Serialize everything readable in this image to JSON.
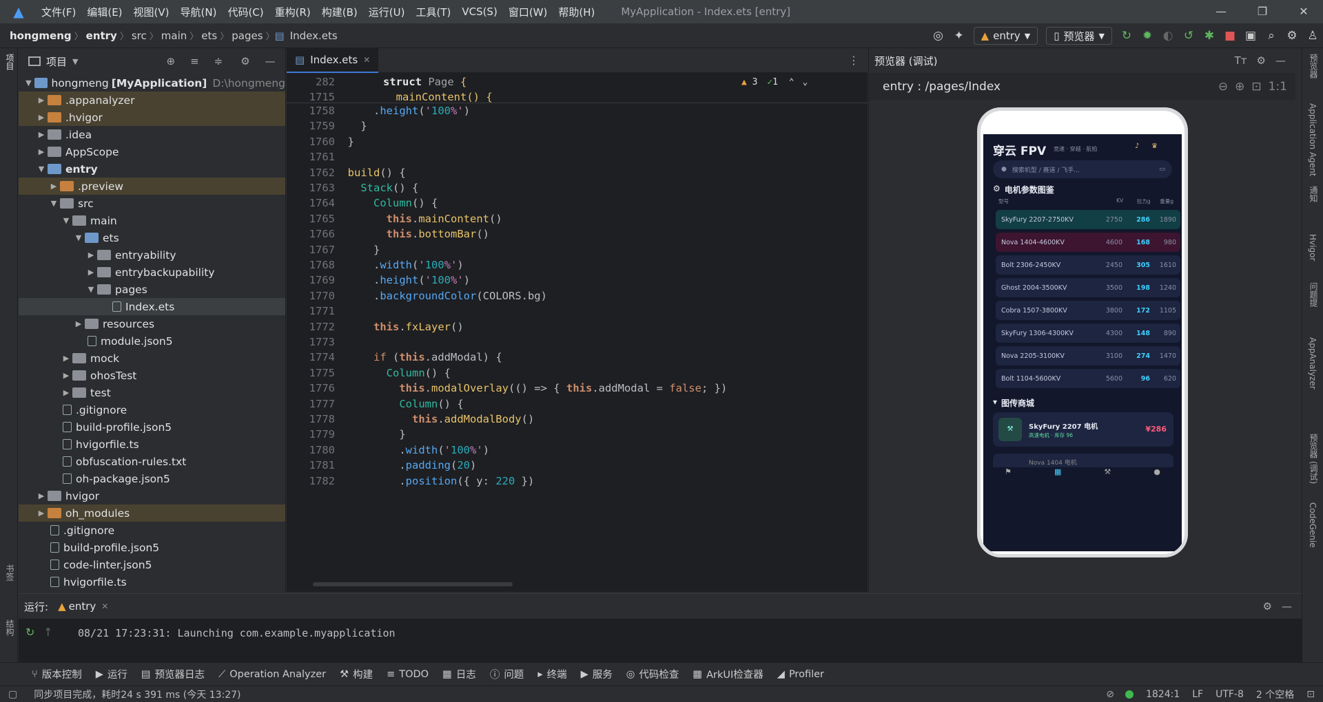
{
  "menubar": {
    "items": [
      "文件(F)",
      "编辑(E)",
      "视图(V)",
      "导航(N)",
      "代码(C)",
      "重构(R)",
      "构建(B)",
      "运行(U)",
      "工具(T)",
      "VCS(S)",
      "窗口(W)",
      "帮助(H)"
    ],
    "title": "MyApplication - Index.ets [entry]"
  },
  "breadcrumb": [
    "hongmeng",
    "entry",
    "src",
    "main",
    "ets",
    "pages",
    "Index.ets"
  ],
  "toolbar": {
    "run_config": "entry",
    "device": "预览器"
  },
  "project": {
    "title": "项目",
    "tree": [
      {
        "label": "hongmeng",
        "extra": "[MyApplication]",
        "path": "D:\\hongmeng",
        "depth": 0,
        "open": true,
        "kind": "b"
      },
      {
        "label": ".appanalyzer",
        "depth": 1,
        "open": false,
        "kind": "o",
        "hl": true
      },
      {
        "label": ".hvigor",
        "depth": 1,
        "open": false,
        "kind": "o",
        "hl": true
      },
      {
        "label": ".idea",
        "depth": 1,
        "open": false,
        "kind": "g"
      },
      {
        "label": "AppScope",
        "depth": 1,
        "open": false,
        "kind": "g"
      },
      {
        "label": "entry",
        "depth": 1,
        "open": true,
        "kind": "b",
        "bold": true
      },
      {
        "label": ".preview",
        "depth": 2,
        "open": false,
        "kind": "o",
        "hl": true
      },
      {
        "label": "src",
        "depth": 2,
        "open": true,
        "kind": "g"
      },
      {
        "label": "main",
        "depth": 3,
        "open": true,
        "kind": "g"
      },
      {
        "label": "ets",
        "depth": 4,
        "open": true,
        "kind": "b"
      },
      {
        "label": "entryability",
        "depth": 5,
        "open": false,
        "kind": "g"
      },
      {
        "label": "entrybackupability",
        "depth": 5,
        "open": false,
        "kind": "g"
      },
      {
        "label": "pages",
        "depth": 5,
        "open": true,
        "kind": "g"
      },
      {
        "label": "Index.ets",
        "depth": 6,
        "file": true
      },
      {
        "label": "resources",
        "depth": 4,
        "open": false,
        "kind": "g"
      },
      {
        "label": "module.json5",
        "depth": 4,
        "file": true
      },
      {
        "label": "mock",
        "depth": 3,
        "open": false,
        "kind": "g"
      },
      {
        "label": "ohosTest",
        "depth": 3,
        "open": false,
        "kind": "g"
      },
      {
        "label": "test",
        "depth": 3,
        "open": false,
        "kind": "g"
      },
      {
        "label": ".gitignore",
        "depth": 2,
        "file": true
      },
      {
        "label": "build-profile.json5",
        "depth": 2,
        "file": true
      },
      {
        "label": "hvigorfile.ts",
        "depth": 2,
        "file": true
      },
      {
        "label": "obfuscation-rules.txt",
        "depth": 2,
        "file": true
      },
      {
        "label": "oh-package.json5",
        "depth": 2,
        "file": true
      },
      {
        "label": "hvigor",
        "depth": 1,
        "open": false,
        "kind": "g"
      },
      {
        "label": "oh_modules",
        "depth": 1,
        "open": false,
        "kind": "o",
        "hl": true
      },
      {
        "label": ".gitignore",
        "depth": 1,
        "file": true
      },
      {
        "label": "build-profile.json5",
        "depth": 1,
        "file": true
      },
      {
        "label": "code-linter.json5",
        "depth": 1,
        "file": true
      },
      {
        "label": "hvigorfile.ts",
        "depth": 1,
        "file": true
      }
    ]
  },
  "editor": {
    "tab": "Index.ets",
    "sticky": [
      [
        "282",
        "struct Page {"
      ],
      [
        "1715",
        "  mainContent() {"
      ]
    ],
    "warnings": "3",
    "ok": "1",
    "lines": [
      [
        "1758",
        "      .height('100%')"
      ],
      [
        "1759",
        "    }"
      ],
      [
        "1760",
        "  }"
      ],
      [
        "1761",
        ""
      ],
      [
        "1762",
        "  build() {"
      ],
      [
        "1763",
        "    Stack() {"
      ],
      [
        "1764",
        "      Column() {"
      ],
      [
        "1765",
        "        this.mainContent()"
      ],
      [
        "1766",
        "        this.bottomBar()"
      ],
      [
        "1767",
        "      }"
      ],
      [
        "1768",
        "      .width('100%')"
      ],
      [
        "1769",
        "      .height('100%')"
      ],
      [
        "1770",
        "      .backgroundColor(COLORS.bg)"
      ],
      [
        "1771",
        ""
      ],
      [
        "1772",
        "      this.fxLayer()"
      ],
      [
        "1773",
        ""
      ],
      [
        "1774",
        "      if (this.addModal) {"
      ],
      [
        "1775",
        "        Column() {"
      ],
      [
        "1776",
        "          this.modalOverlay(() => { this.addModal = false; })"
      ],
      [
        "1777",
        "          Column() {"
      ],
      [
        "1778",
        "            this.addModalBody()"
      ],
      [
        "1779",
        "          }"
      ],
      [
        "1780",
        "          .width('100%')"
      ],
      [
        "1781",
        "          .padding(20)"
      ],
      [
        "1782",
        "          .position({ y: 220 })"
      ]
    ]
  },
  "preview": {
    "title": "预览器 (调试)",
    "route": "entry : /pages/Index",
    "app": {
      "brand": "穿云 FPV",
      "tags": "竞速 · 穿越 · 航拍",
      "search": "搜索机型 / 赛道 / 飞手...",
      "section1": "电机参数图鉴",
      "cols": [
        "型号",
        "KV",
        "拉力g",
        "重量g"
      ],
      "motors": [
        [
          "SkyFury 2207-2750KV",
          "2750",
          "286",
          "1890"
        ],
        [
          "Nova 1404-4600KV",
          "4600",
          "168",
          "980"
        ],
        [
          "Bolt 2306-2450KV",
          "2450",
          "305",
          "1610"
        ],
        [
          "Ghost 2004-3500KV",
          "3500",
          "198",
          "1240"
        ],
        [
          "Cobra 1507-3800KV",
          "3800",
          "172",
          "1105"
        ],
        [
          "SkyFury 1306-4300KV",
          "4300",
          "148",
          "890"
        ],
        [
          "Nova 2205-3100KV",
          "3100",
          "274",
          "1470"
        ],
        [
          "Bolt 1104-5600KV",
          "5600",
          "96",
          "620"
        ]
      ],
      "section2": "图传商城",
      "product": {
        "name": "SkyFury 2207 电机",
        "sub": "高速电机 · 库存 96",
        "price": "¥286"
      },
      "product2": "Nova 1404 电机"
    }
  },
  "run": {
    "label": "运行:",
    "config": "entry",
    "log": "08/21 17:23:31: Launching com.example.myapplication"
  },
  "bottom": [
    "版本控制",
    "运行",
    "预览器日志",
    "Operation Analyzer",
    "构建",
    "TODO",
    "日志",
    "问题",
    "终端",
    "服务",
    "代码检查",
    "ArkUI检查器",
    "Profiler"
  ],
  "status": {
    "msg": "同步项目完成，耗时24 s 391 ms (今天 13:27)",
    "pos": "1824:1",
    "lf": "LF",
    "enc": "UTF-8",
    "indent": "2 个空格"
  },
  "right_strip": [
    "预览器",
    "Application Agent",
    "通知",
    "Hvigor",
    "问题提",
    "AppAnalyzer",
    "预览器 (调试)",
    "CodeGenie"
  ],
  "left_strip": [
    "项目",
    "书签",
    "结构"
  ]
}
